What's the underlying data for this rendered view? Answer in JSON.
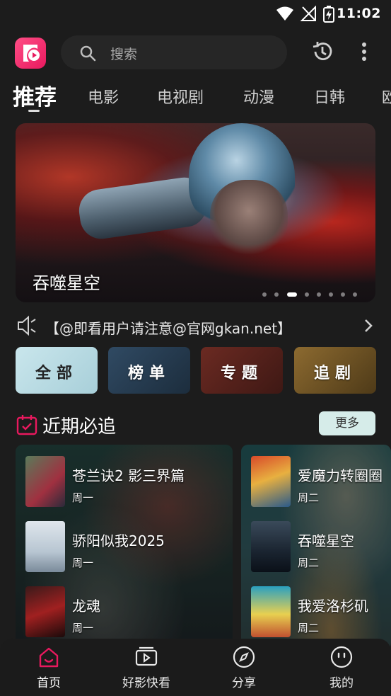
{
  "status_bar": {
    "time": "11:02"
  },
  "header": {
    "search_placeholder": "搜索"
  },
  "tabs": [
    "推荐",
    "电影",
    "电视剧",
    "动漫",
    "日韩",
    "欧"
  ],
  "banner": {
    "title": "吞噬星空"
  },
  "notice": {
    "text": "【@即看用户请注意@官网gkan.net】"
  },
  "categories": [
    "全部",
    "榜单",
    "专题",
    "追剧"
  ],
  "section": {
    "title": "近期必追",
    "more": "更多"
  },
  "cards": [
    {
      "items": [
        {
          "name": "苍兰诀2 影三界篇",
          "day": "周一"
        },
        {
          "name": "骄阳似我2025",
          "day": "周一"
        },
        {
          "name": "龙魂",
          "day": "周一"
        }
      ]
    },
    {
      "items": [
        {
          "name": "爱魔力转圈圈",
          "day": "周二"
        },
        {
          "name": "吞噬星空",
          "day": "周二"
        },
        {
          "name": "我爱洛杉矶",
          "day": "周二"
        }
      ]
    }
  ],
  "bottom_nav": [
    {
      "label": "首页",
      "icon": "home-icon",
      "active": true
    },
    {
      "label": "好影快看",
      "icon": "video-icon",
      "active": false
    },
    {
      "label": "分享",
      "icon": "compass-icon",
      "active": false
    },
    {
      "label": "我的",
      "icon": "smiley-icon",
      "active": false
    }
  ],
  "colors": {
    "accent": "#e8195e",
    "background": "#1c1c1c"
  }
}
